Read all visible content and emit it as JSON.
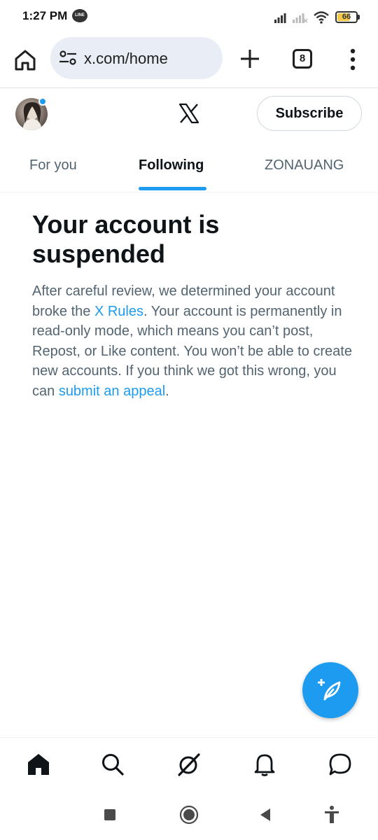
{
  "status_bar": {
    "time": "1:27 PM",
    "line_badge": "LINE",
    "battery_level": "66",
    "battery_fraction": 0.66,
    "icons": [
      "signal-icon",
      "signal-off-icon",
      "wifi-icon",
      "battery-icon"
    ]
  },
  "browser": {
    "url": "x.com/home",
    "tab_count": "8"
  },
  "header": {
    "subscribe_label": "Subscribe"
  },
  "tabs": [
    {
      "label": "For you",
      "active": false
    },
    {
      "label": "Following",
      "active": true
    },
    {
      "label": "ZONAUANG",
      "active": false
    }
  ],
  "notice": {
    "title": "Your account is suspended",
    "body_part1": "After careful review, we determined your account broke the ",
    "rules_link": "X Rules",
    "body_part2": ". Your account is permanently in read-only mode, which means you can’t post, Repost, or Like content. You won’t be able to create new accounts. If you think we got this wrong, you can ",
    "appeal_link": "submit an appeal",
    "body_part3": "."
  },
  "bottom_nav": [
    "home-icon",
    "search-icon",
    "grok-icon",
    "notifications-icon",
    "messages-icon"
  ],
  "colors": {
    "accent": "#1d9bf0",
    "text_primary": "#0f1419",
    "text_secondary": "#536471",
    "url_pill": "#e9eef6"
  }
}
